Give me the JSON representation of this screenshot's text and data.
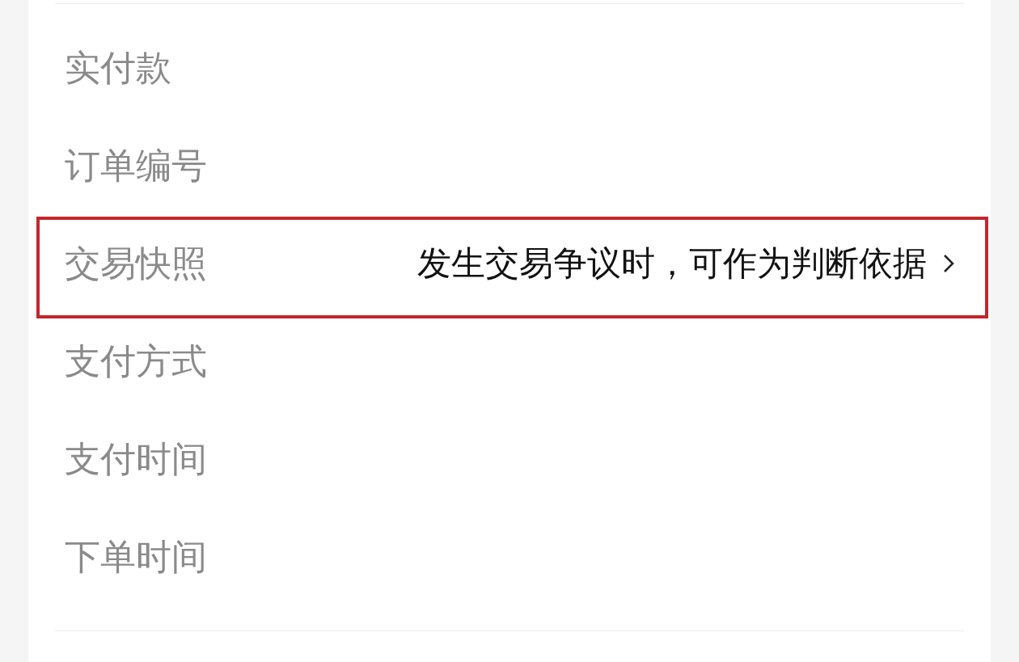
{
  "order_details": {
    "rows": [
      {
        "label": "实付款",
        "highlighted": false,
        "disclosure": false
      },
      {
        "label": "订单编号",
        "highlighted": false,
        "disclosure": false
      },
      {
        "label": "交易快照",
        "value": "发生交易争议时，可作为判断依据",
        "highlighted": true,
        "disclosure": true
      },
      {
        "label": "支付方式",
        "highlighted": false,
        "disclosure": false
      },
      {
        "label": "支付时间",
        "highlighted": false,
        "disclosure": false
      },
      {
        "label": "下单时间",
        "highlighted": false,
        "disclosure": false
      }
    ]
  }
}
